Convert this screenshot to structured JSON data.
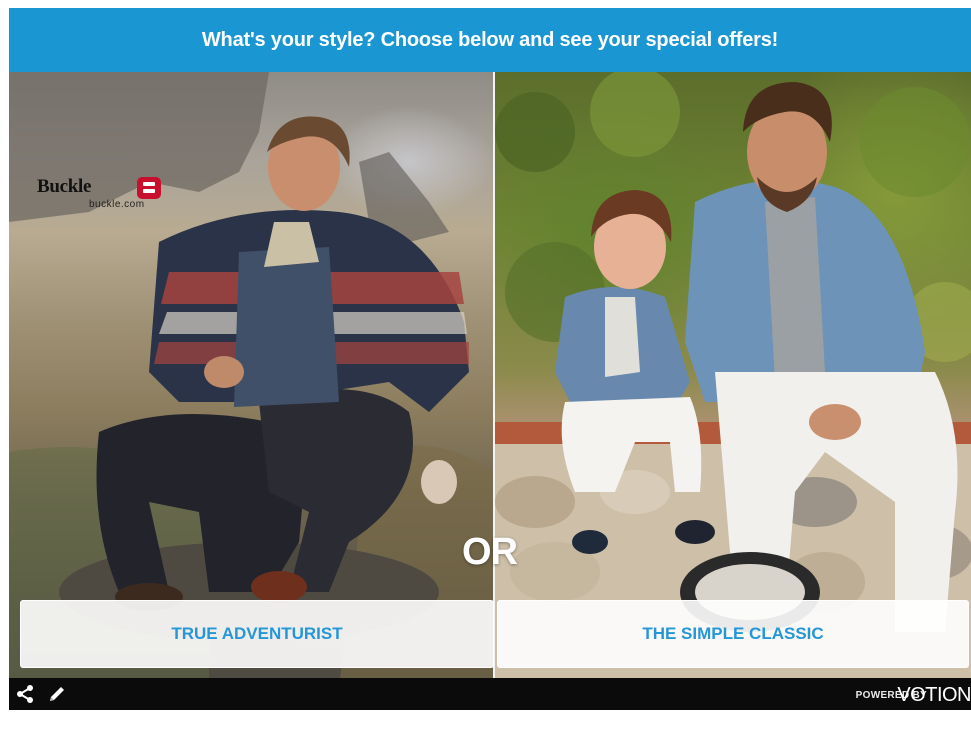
{
  "banner": {
    "text": "What's your style? Choose below and see your special offers!"
  },
  "logo": {
    "name": "Buckle",
    "url": "buckle.com"
  },
  "separator": {
    "text": "OR"
  },
  "choices": [
    {
      "label": "TRUE ADVENTURIST"
    },
    {
      "label": "THE SIMPLE CLASSIC"
    }
  ],
  "footer": {
    "powered_by": "POWERED BY",
    "brand": "VOTION"
  },
  "icons": {
    "share": "share-icon",
    "edit": "pencil-icon"
  },
  "colors": {
    "banner": "#1a96d3",
    "choice_text": "#2596d6",
    "footer": "#0b0b0b"
  }
}
